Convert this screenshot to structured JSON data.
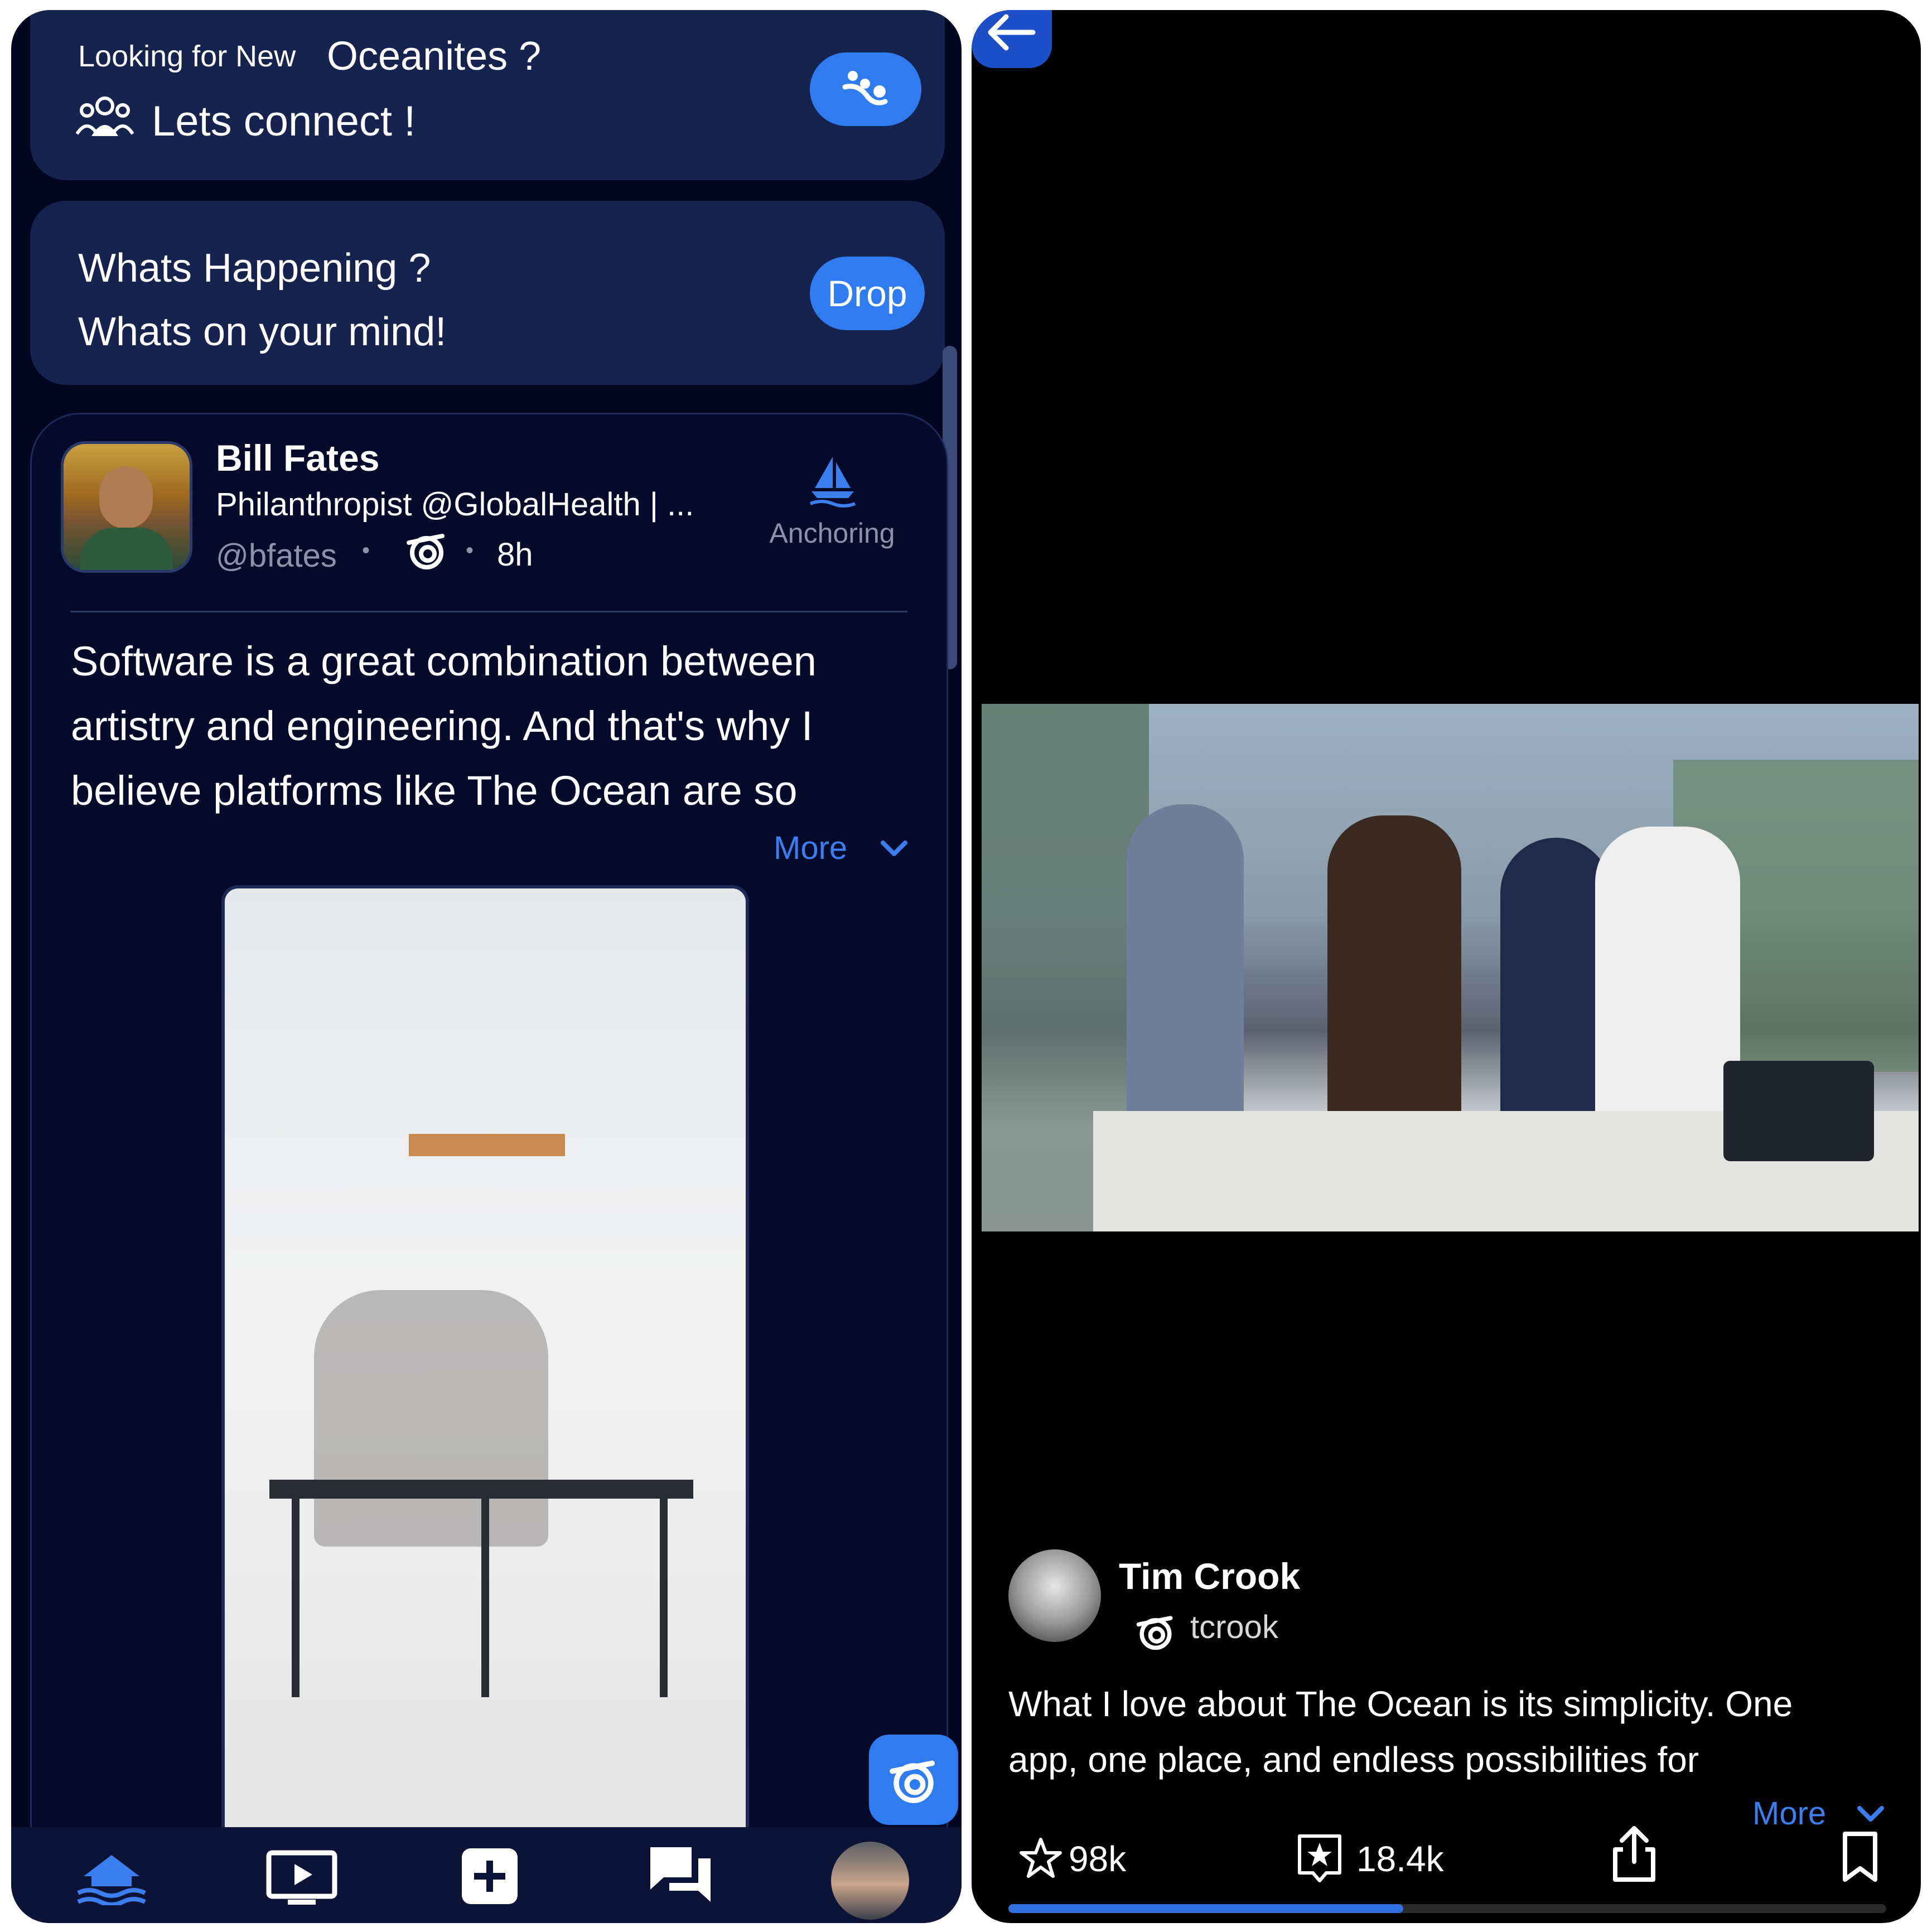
{
  "connect_card": {
    "prefix": "Looking for New",
    "highlight": "Oceanites ?",
    "subtitle": "Lets connect !",
    "icon": "people-group-icon",
    "button_icon": "wave-connect-icon"
  },
  "composer": {
    "line1": "Whats Happening ?",
    "line2": "Whats on your mind!",
    "button_label": "Drop"
  },
  "post": {
    "author_name": "Bill Fates",
    "bio": "Philanthropist @GlobalHealth | ...",
    "handle": "@bfates",
    "separator": "•",
    "time": "8h",
    "badge_icon": "ocean-swirl-icon",
    "anchor_label": "Anchoring",
    "anchor_icon": "sailboat-icon",
    "text_line1": "Software is a great combination between",
    "text_line2": "artistry and engineering. And that's why I",
    "text_line3": "believe platforms like The Ocean are so",
    "more_label": "More"
  },
  "fab": {
    "icon": "ocean-swirl-icon"
  },
  "bottom_nav": [
    {
      "name": "home",
      "icon": "ocean-home-icon"
    },
    {
      "name": "video",
      "icon": "video-play-icon"
    },
    {
      "name": "create",
      "icon": "plus-square-icon"
    },
    {
      "name": "messages",
      "icon": "chat-bubbles-icon"
    },
    {
      "name": "profile",
      "icon": "avatar-icon"
    }
  ],
  "viewer": {
    "back_icon": "arrow-left-icon",
    "author_name": "Tim Crook",
    "username": "tcrook",
    "text_line1": "What I love about The Ocean is its simplicity. One",
    "text_line2": "app, one place, and endless possibilities for",
    "more_label": "More",
    "stars_count": "98k",
    "boosts_count": "18.4k",
    "progress": 0.45
  },
  "colors": {
    "accent": "#2f7bf0",
    "card_bg": "#16234f",
    "feed_bg": "#020620",
    "viewer_bg": "#000000",
    "link": "#3a7ef0"
  }
}
